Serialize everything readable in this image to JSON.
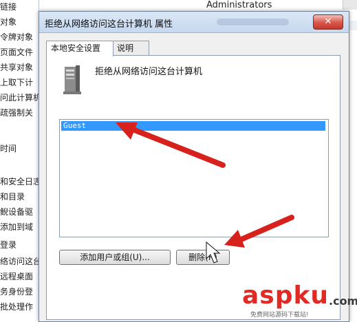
{
  "background": {
    "policy_items": [
      "链接",
      "对象",
      "令牌对象",
      "页面文件",
      "共享对象",
      "上取下计",
      "问此计算机",
      "疏强制关",
      "",
      "时间",
      "",
      "和安全日志",
      "和目录",
      "鲵设备驱",
      "添加到域",
      "登录",
      "络访问这台",
      "远程桌面",
      "务身份登",
      "批处理作"
    ],
    "header_column": "Administrators"
  },
  "dialog": {
    "title": "拒绝从网络访问这台计算机 属性",
    "close_glyph": "✕",
    "tabs": [
      "本地安全设置",
      "说明"
    ],
    "policy_name": "拒绝从网络访问这台计算机",
    "list_items": [
      "Guest"
    ],
    "buttons": {
      "add": "添加用户或组(U)...",
      "remove": "删除(R)"
    }
  },
  "watermark": {
    "brand": "aspku",
    "suffix": ".com",
    "subtitle": "免费网站源码下载站!"
  },
  "colors": {
    "selection": "#3399ff",
    "arrow": "#d6211c",
    "titlebar": "#c6d8ef",
    "close": "#d8564b"
  }
}
